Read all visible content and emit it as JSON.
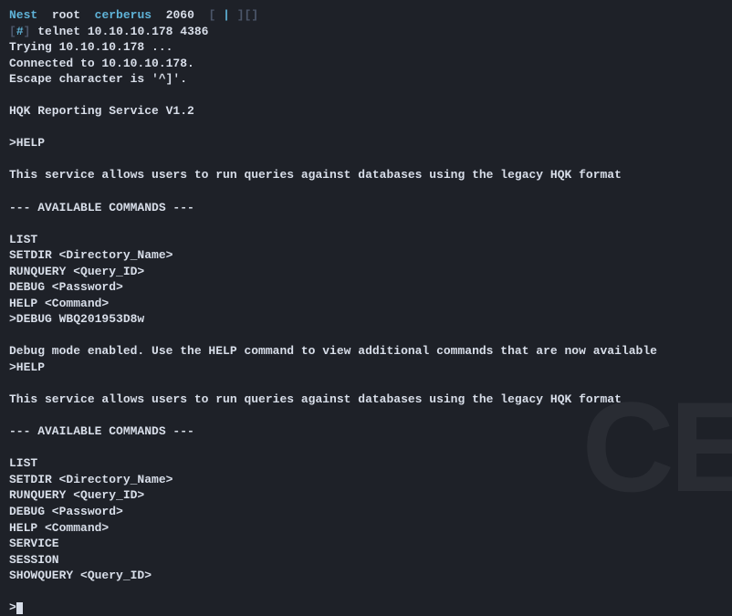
{
  "status": {
    "host": "Nest",
    "user": "root",
    "machine": "cerberus",
    "pid": "2060",
    "extra1": "[",
    "pipe": "|",
    "extra2": "]",
    "arrows": "",
    "arrows2": "",
    "brackets3": "[]"
  },
  "prompt": {
    "open": "[",
    "hash": "#",
    "close": "]",
    "command": "telnet 10.10.10.178 4386"
  },
  "lines": {
    "l1": "Trying 10.10.10.178 ...",
    "l2": "Connected to 10.10.10.178.",
    "l3": "Escape character is '^]'.",
    "l4": "HQK Reporting Service V1.2",
    "l5": ">HELP",
    "l6": "This service allows users to run queries against databases using the legacy HQK format",
    "l7": "--- AVAILABLE COMMANDS ---",
    "l8": "LIST",
    "l9": "SETDIR <Directory_Name>",
    "l10": "RUNQUERY <Query_ID>",
    "l11": "DEBUG <Password>",
    "l12": "HELP <Command>",
    "l13": ">DEBUG WBQ201953D8w",
    "l14": "Debug mode enabled. Use the HELP command to view additional commands that are now available",
    "l15": ">HELP",
    "l16": "This service allows users to run queries against databases using the legacy HQK format",
    "l17": "--- AVAILABLE COMMANDS ---",
    "l18": "LIST",
    "l19": "SETDIR <Directory_Name>",
    "l20": "RUNQUERY <Query_ID>",
    "l21": "DEBUG <Password>",
    "l22": "HELP <Command>",
    "l23": "SERVICE",
    "l24": "SESSION",
    "l25": "SHOWQUERY <Query_ID>",
    "l26": ">"
  },
  "watermark": "CE"
}
